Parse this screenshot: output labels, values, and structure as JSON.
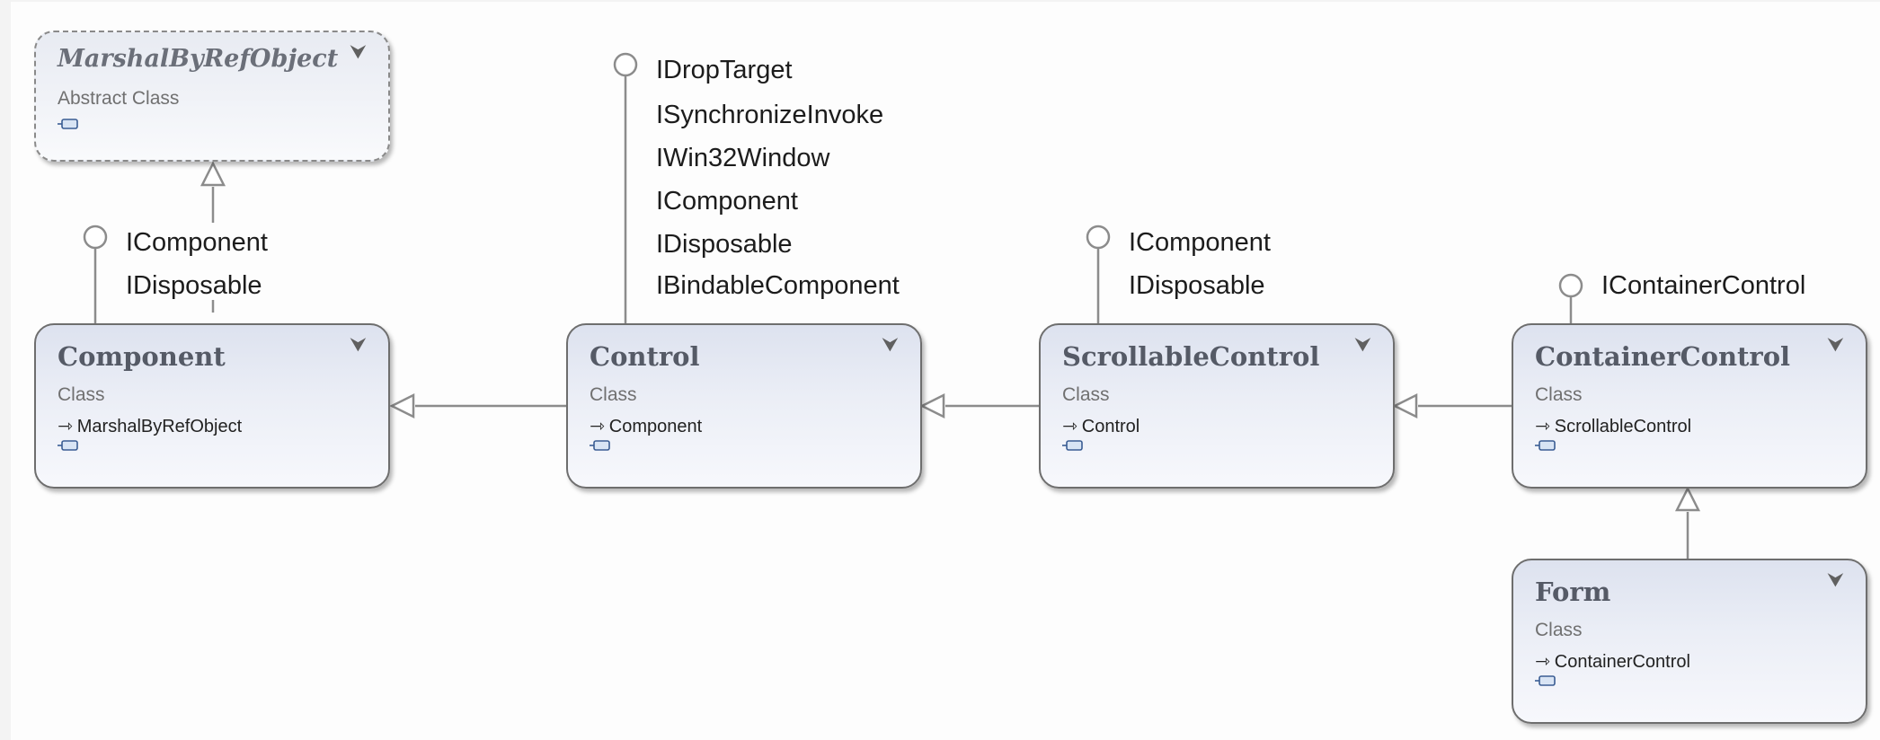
{
  "classes": [
    {
      "name": "MarshalByRefObject",
      "kind": "Abstract Class",
      "abstract": true,
      "base": ""
    },
    {
      "name": "Component",
      "kind": "Class",
      "abstract": false,
      "base": "MarshalByRefObject"
    },
    {
      "name": "Control",
      "kind": "Class",
      "abstract": false,
      "base": "Component"
    },
    {
      "name": "ScrollableControl",
      "kind": "Class",
      "abstract": false,
      "base": "Control"
    },
    {
      "name": "ContainerControl",
      "kind": "Class",
      "abstract": false,
      "base": "ScrollableControl"
    },
    {
      "name": "Form",
      "kind": "Class",
      "abstract": false,
      "base": "ContainerControl"
    }
  ],
  "interfaces": {
    "component": [
      "IComponent",
      "IDisposable"
    ],
    "control": [
      "IDropTarget",
      "ISynchronizeInvoke",
      "IWin32Window",
      "IComponent",
      "IDisposable",
      "IBindableComponent"
    ],
    "scrollable": [
      "IComponent",
      "IDisposable"
    ],
    "container": [
      "IContainerControl"
    ]
  },
  "icons": {
    "collapse": "double-chevron-down-icon",
    "inherit": "inheritance-arrow-icon",
    "members": "members-compartment-icon",
    "lollipop": "interface-lollipop-icon"
  },
  "colors": {
    "border": "#6e6e6e",
    "line": "#8c8c8c",
    "box_top": "#dde2ef",
    "box_bottom": "#f7f8fc",
    "text": "#1c1c1c"
  }
}
